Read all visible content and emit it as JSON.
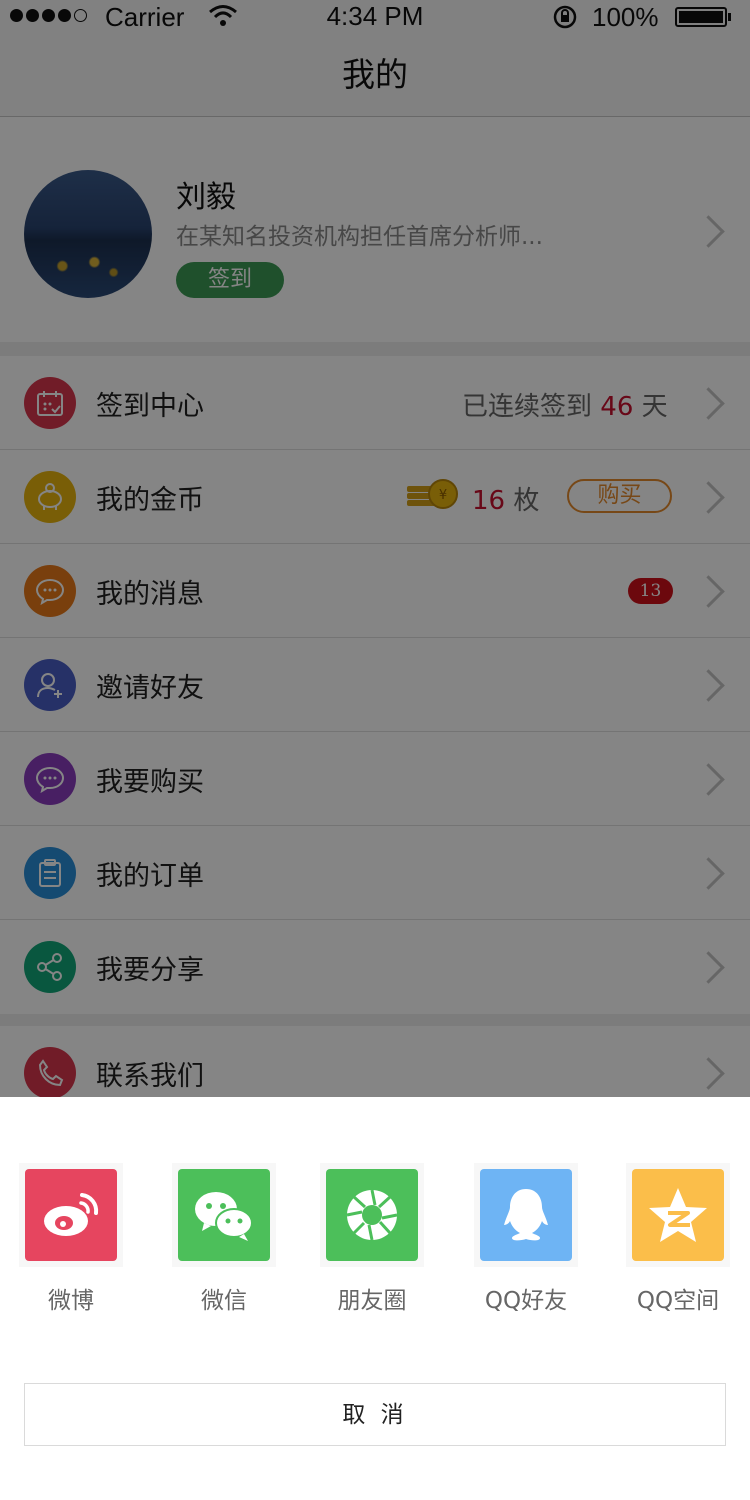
{
  "status_bar": {
    "carrier": "Carrier",
    "time": "4:34 PM",
    "battery": "100%"
  },
  "nav": {
    "title": "我的"
  },
  "profile": {
    "name": "刘毅",
    "bio": "在某知名投资机构担任首席分析师...",
    "checkin_label": "签到"
  },
  "menu": {
    "checkin_center": {
      "label": "签到中心",
      "streak_prefix": "已连续签到",
      "streak_days": "46",
      "streak_suffix": "天"
    },
    "coins": {
      "label": "我的金币",
      "count": "16",
      "unit": "枚",
      "buy_label": "购买"
    },
    "messages": {
      "label": "我的消息",
      "badge": "13"
    },
    "invite": {
      "label": "邀请好友"
    },
    "want_buy": {
      "label": "我要购买"
    },
    "orders": {
      "label": "我的订单"
    },
    "share": {
      "label": "我要分享"
    },
    "contact": {
      "label": "联系我们"
    }
  },
  "share_sheet": {
    "targets": [
      {
        "label": "微博",
        "icon": "weibo-icon",
        "color": "#e6455f"
      },
      {
        "label": "微信",
        "icon": "wechat-icon",
        "color": "#4cbf5a"
      },
      {
        "label": "朋友圈",
        "icon": "moments-icon",
        "color": "#4cbf5a"
      },
      {
        "label": "QQ好友",
        "icon": "qq-icon",
        "color": "#6eb4f4"
      },
      {
        "label": "QQ空间",
        "icon": "qzone-icon",
        "color": "#fbbe4a"
      }
    ],
    "cancel_label": "取 消"
  },
  "colors": {
    "accent_red": "#c8102e",
    "checkin_green": "#3c9a55",
    "buy_orange": "#e58a2c",
    "overlay": "rgba(0,0,0,0.48)"
  }
}
